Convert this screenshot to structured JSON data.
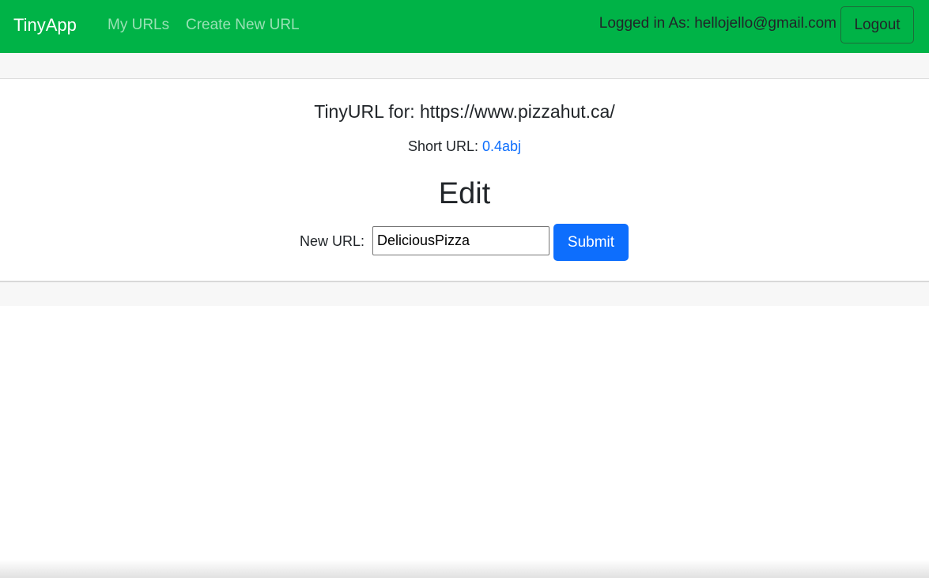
{
  "navbar": {
    "brand": "TinyApp",
    "links": [
      {
        "label": "My URLs"
      },
      {
        "label": "Create New URL"
      }
    ],
    "logged_in_text": "Logged in As: hellojello@gmail.com",
    "logout_label": "Logout",
    "bg_color": "#00b347"
  },
  "main": {
    "title": "TinyURL for: https://www.pizzahut.ca/",
    "short_url_label": "Short URL:",
    "short_url_value": "0.4abj",
    "edit_heading": "Edit",
    "form": {
      "label": "New URL:",
      "input_value": "DeliciousPizza",
      "submit_label": "Submit"
    },
    "link_color": "#0d6efd"
  }
}
